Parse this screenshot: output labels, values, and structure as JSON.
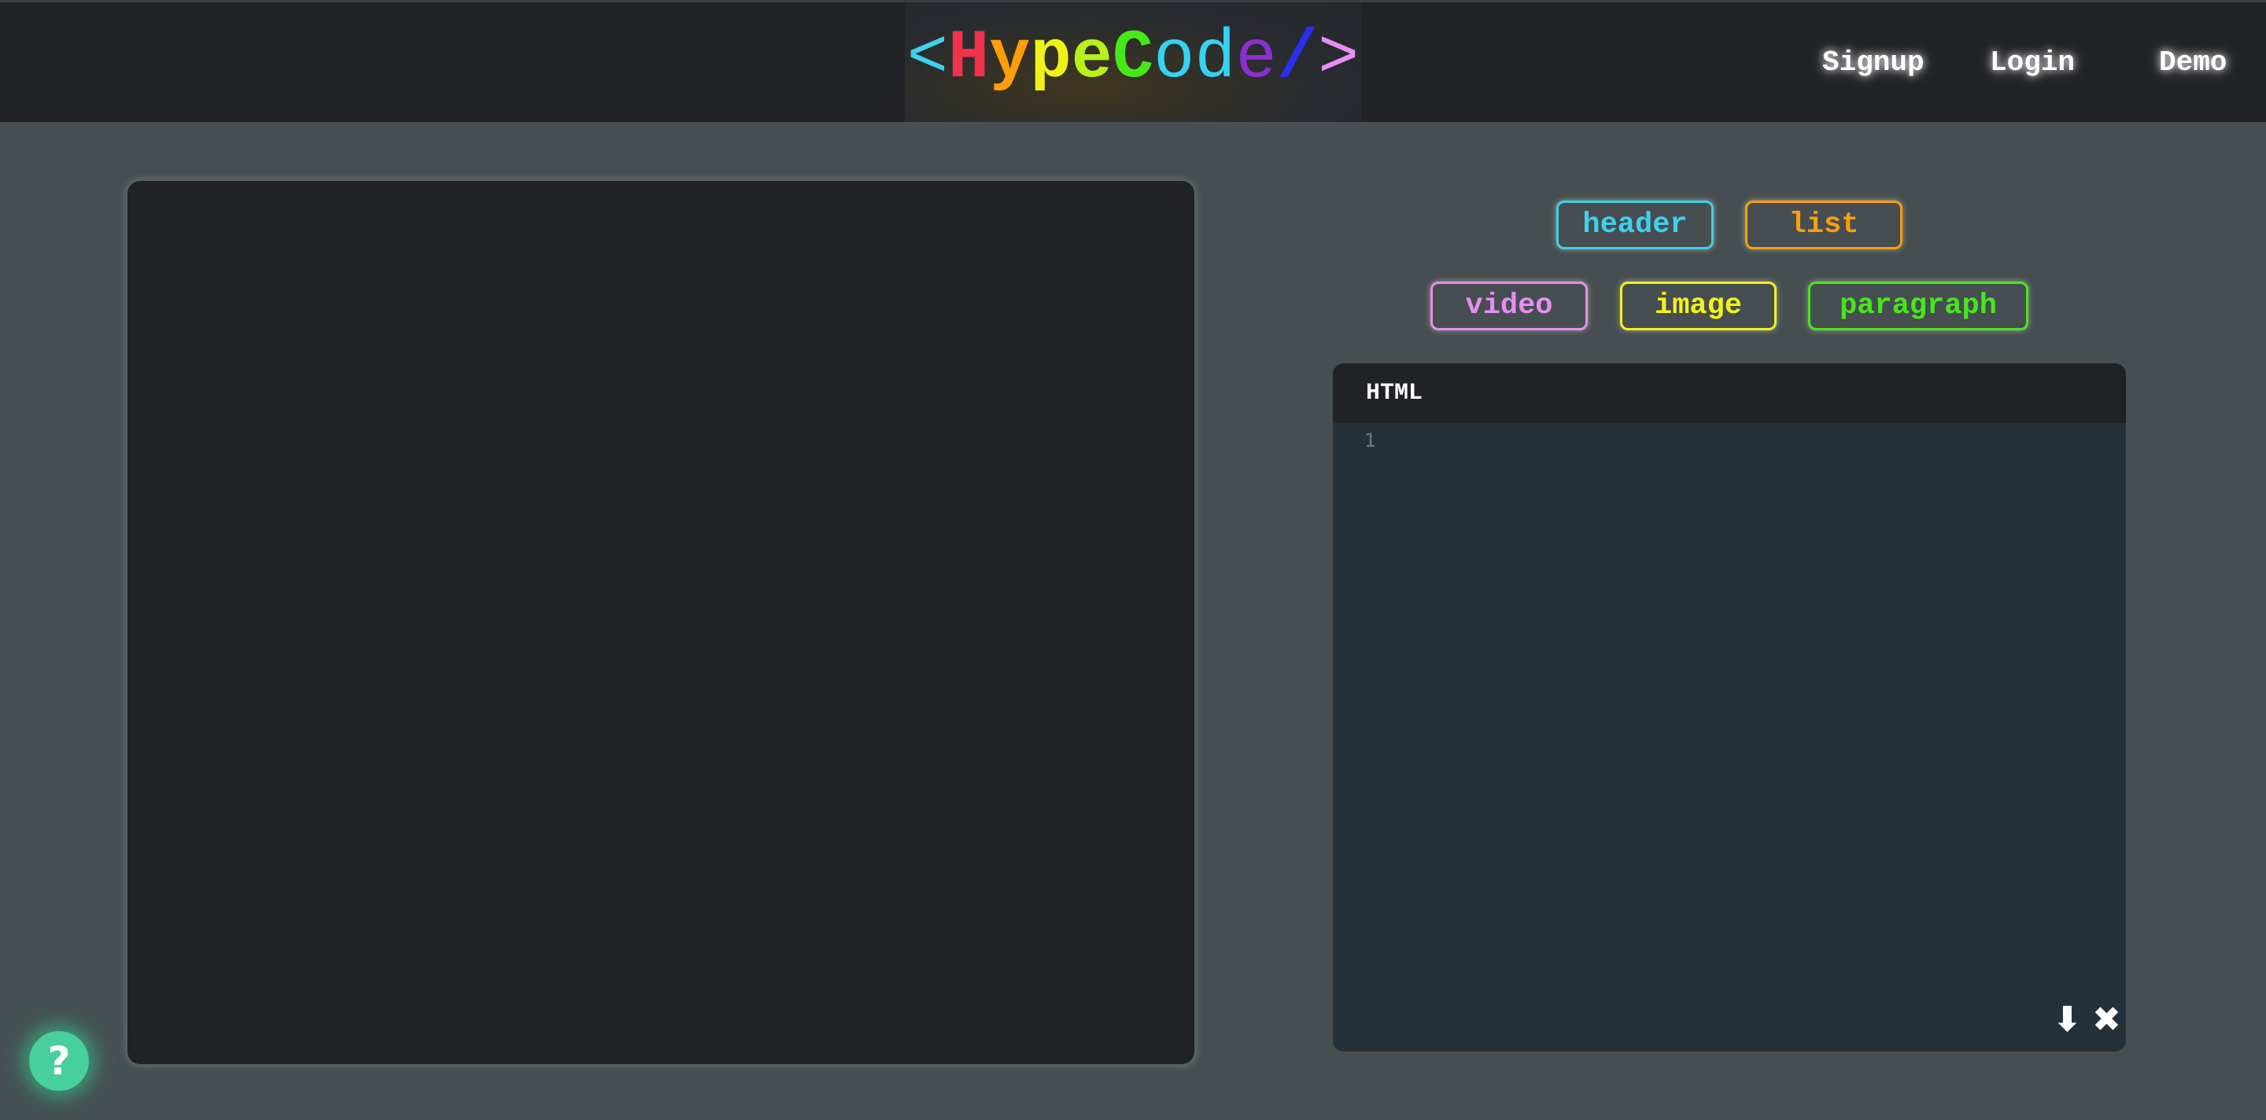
{
  "header": {
    "logo": {
      "parts": [
        {
          "text": "<",
          "color": "#3fd0ee"
        },
        {
          "text": "H",
          "color": "#f0334a"
        },
        {
          "text": "y",
          "color": "#ff9d0a"
        },
        {
          "text": "p",
          "color": "#eff21a"
        },
        {
          "text": "e",
          "color": "#b8f01a"
        },
        {
          "text": "C",
          "color": "#46e81a"
        },
        {
          "text": "o",
          "color": "#36d2f2"
        },
        {
          "text": "d",
          "color": "#36d2f2"
        },
        {
          "text": "e",
          "color": "#8a2fd0"
        },
        {
          "text": "/",
          "color": "#2a2ff0"
        },
        {
          "text": ">",
          "color": "#e88ef0"
        }
      ]
    },
    "nav": {
      "signup": "Signup",
      "login": "Login",
      "demo": "Demo"
    }
  },
  "element_buttons": [
    {
      "label": "header",
      "color": "#3fd0ee"
    },
    {
      "label": "list",
      "color": "#ff9f0a"
    },
    {
      "label": "video",
      "color": "#e88ef0"
    },
    {
      "label": "image",
      "color": "#f2f21a"
    },
    {
      "label": "paragraph",
      "color": "#46e81a"
    }
  ],
  "editor": {
    "title": "HTML",
    "line_numbers": [
      "1"
    ],
    "content": "",
    "download_icon": "⬇",
    "clear_icon": "✖"
  },
  "help_button": {
    "label": "?"
  }
}
